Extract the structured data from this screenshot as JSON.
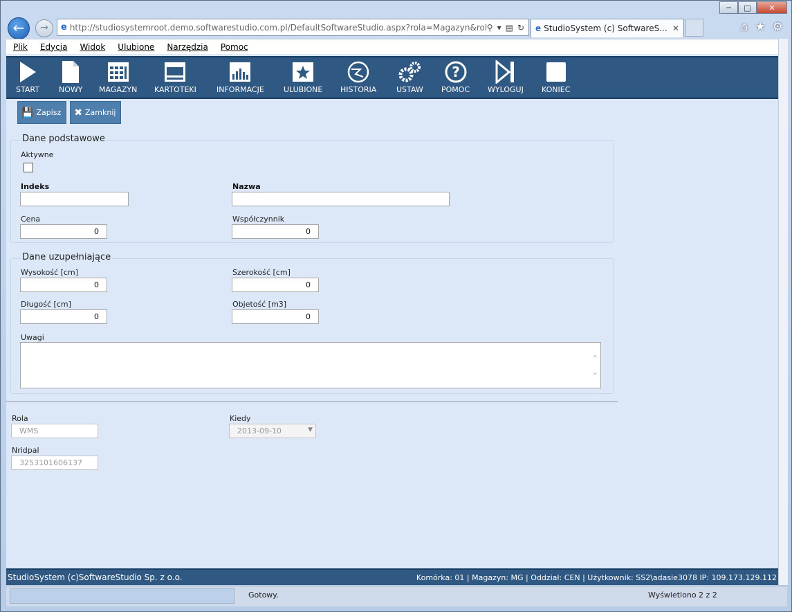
{
  "browser": {
    "url": "http://studiosystemroot.demo.softwarestudio.com.pl/DefaultSoftwareStudio.aspx?rola=Magazyn&rolasys=WM",
    "tab_title": "StudioSystem (c) SoftwareS...",
    "menu": [
      "Plik",
      "Edycja",
      "Widok",
      "Ulubione",
      "Narzędzia",
      "Pomoc"
    ],
    "status_left": "Gotowy.",
    "status_right": "Wyświetlono 2 z 2"
  },
  "toolbar": [
    {
      "label": "START",
      "icon": "play-icon"
    },
    {
      "label": "NOWY",
      "icon": "document-icon"
    },
    {
      "label": "MAGAZYN",
      "icon": "warehouse-grid-icon"
    },
    {
      "label": "KARTOTEKI",
      "icon": "cards-icon"
    },
    {
      "label": "INFORMACJE",
      "icon": "bar-chart-icon"
    },
    {
      "label": "ULUBIONE",
      "icon": "star-icon"
    },
    {
      "label": "HISTORIA",
      "icon": "history-icon"
    },
    {
      "label": "USTAW",
      "icon": "gears-icon"
    },
    {
      "label": "POMOC",
      "icon": "help-icon"
    },
    {
      "label": "WYLOGUJ",
      "icon": "logout-icon"
    },
    {
      "label": "KONIEC",
      "icon": "stop-icon"
    }
  ],
  "actions": {
    "save": "Zapisz",
    "close": "Zamknij"
  },
  "basic": {
    "legend": "Dane podstawowe",
    "active_label": "Aktywne",
    "index_label": "Indeks",
    "index_value": "",
    "name_label": "Nazwa",
    "name_value": "",
    "price_label": "Cena",
    "price_value": "0",
    "factor_label": "Współczynnik",
    "factor_value": "0"
  },
  "extra": {
    "legend": "Dane uzupełniające",
    "height_label": "Wysokość [cm]",
    "height_value": "0",
    "width_label": "Szerokość [cm]",
    "width_value": "0",
    "length_label": "Długość [cm]",
    "length_value": "0",
    "volume_label": "Objetość [m3]",
    "volume_value": "0",
    "notes_label": "Uwagi"
  },
  "meta": {
    "role_label": "Rola",
    "role_value": "WMS",
    "when_label": "Kiedy",
    "when_value": "2013-09-10",
    "nridpal_label": "Nridpal",
    "nridpal_value": "3253101606137"
  },
  "footer": {
    "left": "StudioSystem (c)SoftwareStudio Sp. z o.o.",
    "right": "Komórka: 01 | Magazyn: MG | Oddział: CEN | Użytkownik: SS2\\adasie3078 IP: 109.173.129.112"
  }
}
